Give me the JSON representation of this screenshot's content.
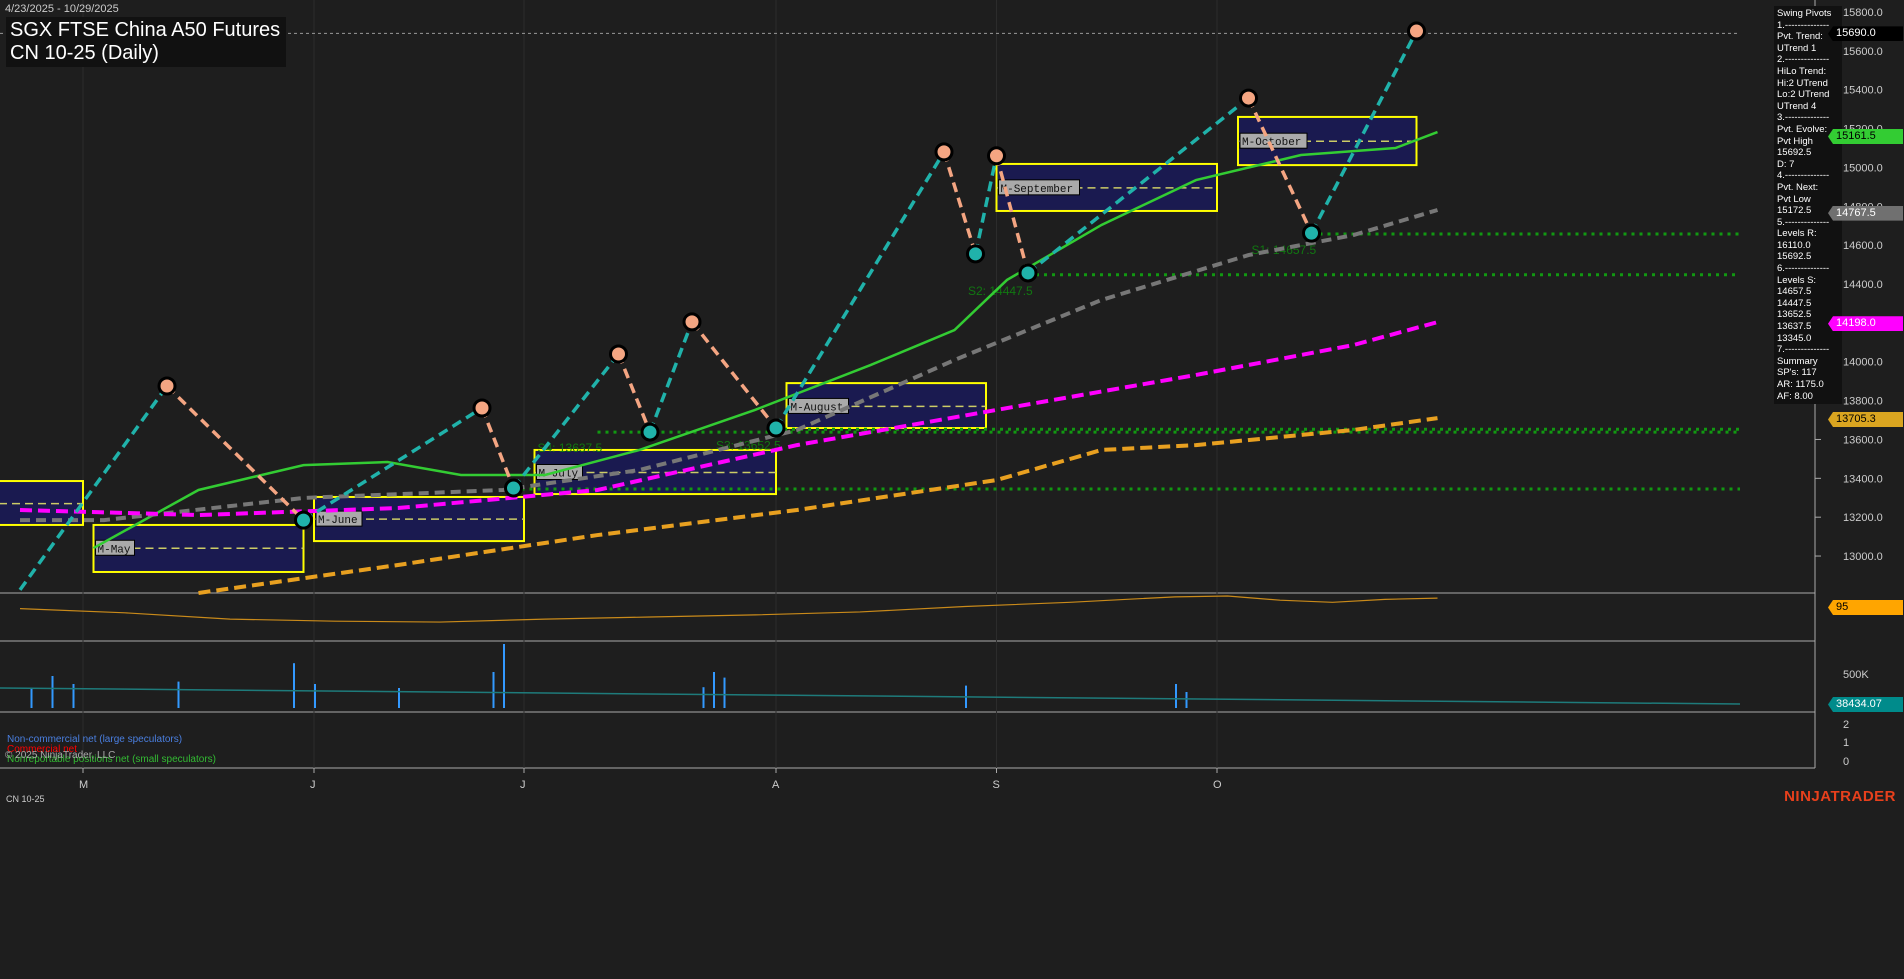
{
  "header": {
    "date_range": "4/23/2025 - 10/29/2025",
    "title_line1": "SGX FTSE China A50 Futures",
    "title_line2": "CN 10-25 (Daily)"
  },
  "pivot_panel": [
    "Swing Pivots",
    "1.--------------",
    "Pvt. Trend:",
    "UTrend 1",
    "2.--------------",
    "HiLo Trend:",
    "Hi:2 UTrend",
    "Lo:2 UTrend",
    "UTrend 4",
    "3.--------------",
    "Pvt. Evolve:",
    "Pvt High",
    "15692.5",
    "D: 7",
    "4.--------------",
    "Pvt. Next:",
    "Pvt Low",
    "15172.5",
    "5.--------------",
    "Levels R:",
    "16110.0",
    "15692.5",
    "6.--------------",
    "Levels S:",
    "14657.5",
    "14447.5",
    "13652.5",
    "13637.5",
    "13345.0",
    "7.--------------",
    "Summary",
    "SP's: 117",
    "AR: 1175.0",
    "AF: 8.00"
  ],
  "price_tags": [
    {
      "text": "15690.0",
      "price": 15690,
      "bg": "#000000",
      "fg": "#ffffff"
    },
    {
      "text": "15161.5",
      "price": 15161.5,
      "bg": "#33cc33",
      "fg": "#000000"
    },
    {
      "text": "14767.5",
      "price": 14767.5,
      "bg": "#707070",
      "fg": "#ffffff"
    },
    {
      "text": "14198.0",
      "price": 14198,
      "bg": "#ff00ff",
      "fg": "#ffffff"
    },
    {
      "text": "13705.3",
      "price": 13705.3,
      "bg": "#daa520",
      "fg": "#000000"
    }
  ],
  "indicator_tags": {
    "osc": "95",
    "cot": "38434.07"
  },
  "volume_axis": "500K",
  "cot_axis": [
    "2",
    "1",
    "0"
  ],
  "legend": {
    "noncomm": "Non-commercial net (large speculators)",
    "comm": "Commercial net",
    "copyright": "© 2025 NinjaTrader, LLC",
    "nonrep": "Nonreportable positions net (small speculators)"
  },
  "instrument": "CN 10-25",
  "logo": "NINJATRADER",
  "chart_data": {
    "type": "line",
    "title": "SGX FTSE China A50 Futures CN 10-25 (Daily)",
    "ylim": [
      12800,
      15850
    ],
    "yticks": [
      13000,
      13200,
      13400,
      13600,
      13800,
      14000,
      14200,
      14400,
      14600,
      14800,
      15000,
      15200,
      15400,
      15600,
      15800
    ],
    "x_months": [
      {
        "label": "M",
        "bar": 6
      },
      {
        "label": "J",
        "bar": 28
      },
      {
        "label": "J",
        "bar": 48
      },
      {
        "label": "A",
        "bar": 72
      },
      {
        "label": "S",
        "bar": 93
      },
      {
        "label": "O",
        "bar": 114
      }
    ],
    "current_price_line": 15690,
    "swings": [
      [
        0,
        12826
      ],
      [
        14,
        13875
      ],
      [
        27,
        13185
      ],
      [
        44,
        13762
      ],
      [
        47,
        13350
      ],
      [
        57,
        14040
      ],
      [
        60,
        13638
      ],
      [
        64,
        14205
      ],
      [
        72,
        13659
      ],
      [
        88,
        15080
      ],
      [
        91,
        14555
      ],
      [
        93,
        15060
      ],
      [
        96,
        14457
      ],
      [
        117,
        15357
      ],
      [
        123,
        14662
      ],
      [
        133,
        15702
      ]
    ],
    "series": [
      {
        "name": "MA green",
        "color": "#33cc33",
        "dash": "",
        "values": [
          [
            7,
            13041
          ],
          [
            17,
            13340
          ],
          [
            27,
            13468
          ],
          [
            35,
            13484
          ],
          [
            42,
            13417
          ],
          [
            50,
            13417
          ],
          [
            59,
            13546
          ],
          [
            70,
            13752
          ],
          [
            81,
            13983
          ],
          [
            89,
            14163
          ],
          [
            94,
            14421
          ],
          [
            103,
            14704
          ],
          [
            112,
            14935
          ],
          [
            122,
            15064
          ],
          [
            131,
            15100
          ],
          [
            135,
            15182
          ]
        ]
      },
      {
        "name": "MA gray",
        "color": "#777777",
        "dash": "10 6",
        "values": [
          [
            0,
            13185
          ],
          [
            8,
            13185
          ],
          [
            27,
            13299
          ],
          [
            46,
            13340
          ],
          [
            59,
            13443
          ],
          [
            74,
            13649
          ],
          [
            89,
            14009
          ],
          [
            103,
            14318
          ],
          [
            117,
            14549
          ],
          [
            127,
            14652
          ],
          [
            135,
            14781
          ]
        ]
      },
      {
        "name": "MA magenta",
        "color": "#ff00ff",
        "dash": "12 6",
        "values": [
          [
            0,
            13237
          ],
          [
            17,
            13211
          ],
          [
            36,
            13247
          ],
          [
            55,
            13340
          ],
          [
            74,
            13571
          ],
          [
            93,
            13752
          ],
          [
            112,
            13932
          ],
          [
            127,
            14086
          ],
          [
            135,
            14204
          ]
        ]
      },
      {
        "name": "MA orange",
        "color": "#e8a020",
        "dash": "12 6",
        "values": [
          [
            17,
            12810
          ],
          [
            36,
            12954
          ],
          [
            55,
            13108
          ],
          [
            74,
            13237
          ],
          [
            93,
            13391
          ],
          [
            103,
            13546
          ],
          [
            112,
            13571
          ],
          [
            127,
            13649
          ],
          [
            135,
            13710
          ]
        ]
      }
    ],
    "value_areas": [
      {
        "label": "",
        "from": -2,
        "to": 6,
        "high": 13386,
        "low": 13160,
        "mid": 13270
      },
      {
        "label": "M-May",
        "from": 7,
        "to": 27,
        "high": 13160,
        "low": 12918,
        "mid": 13040
      },
      {
        "label": "M-June",
        "from": 28,
        "to": 48,
        "high": 13304,
        "low": 13077,
        "mid": 13190
      },
      {
        "label": "M-July",
        "from": 49,
        "to": 72,
        "high": 13546,
        "low": 13319,
        "mid": 13430
      },
      {
        "label": "M-August",
        "from": 73,
        "to": 92,
        "high": 13890,
        "low": 13659,
        "mid": 13770
      },
      {
        "label": "M-September",
        "from": 93,
        "to": 114,
        "high": 15018,
        "low": 14776,
        "mid": 14895
      },
      {
        "label": "M-October",
        "from": 116,
        "to": 133,
        "high": 15260,
        "low": 15012,
        "mid": 15135
      }
    ],
    "supports": [
      {
        "label": "S1: 14657.5",
        "price": 14657.5,
        "from": 123
      },
      {
        "label": "S2: 14447.5",
        "price": 14447.5,
        "from": 96
      },
      {
        "label": "S3: 13652.5",
        "price": 13652.5,
        "from": 72
      },
      {
        "label": "S4: 13637.5",
        "price": 13637.5,
        "from": 55
      },
      {
        "label": "",
        "price": 13345,
        "from": 47
      }
    ],
    "oscillator": [
      [
        0,
        70
      ],
      [
        10,
        60
      ],
      [
        20,
        45
      ],
      [
        30,
        40
      ],
      [
        40,
        38
      ],
      [
        50,
        45
      ],
      [
        60,
        50
      ],
      [
        70,
        55
      ],
      [
        80,
        62
      ],
      [
        90,
        75
      ],
      [
        100,
        85
      ],
      [
        110,
        98
      ],
      [
        115,
        100
      ],
      [
        120,
        90
      ],
      [
        125,
        85
      ],
      [
        130,
        92
      ],
      [
        135,
        95
      ]
    ],
    "volume": [
      [
        1,
        250
      ],
      [
        3,
        400
      ],
      [
        5,
        300
      ],
      [
        15,
        330
      ],
      [
        26,
        560
      ],
      [
        28,
        300
      ],
      [
        36,
        250
      ],
      [
        45,
        450
      ],
      [
        46,
        800
      ],
      [
        65,
        260
      ],
      [
        66,
        450
      ],
      [
        67,
        380
      ],
      [
        90,
        280
      ],
      [
        110,
        300
      ],
      [
        111,
        200
      ]
    ]
  }
}
